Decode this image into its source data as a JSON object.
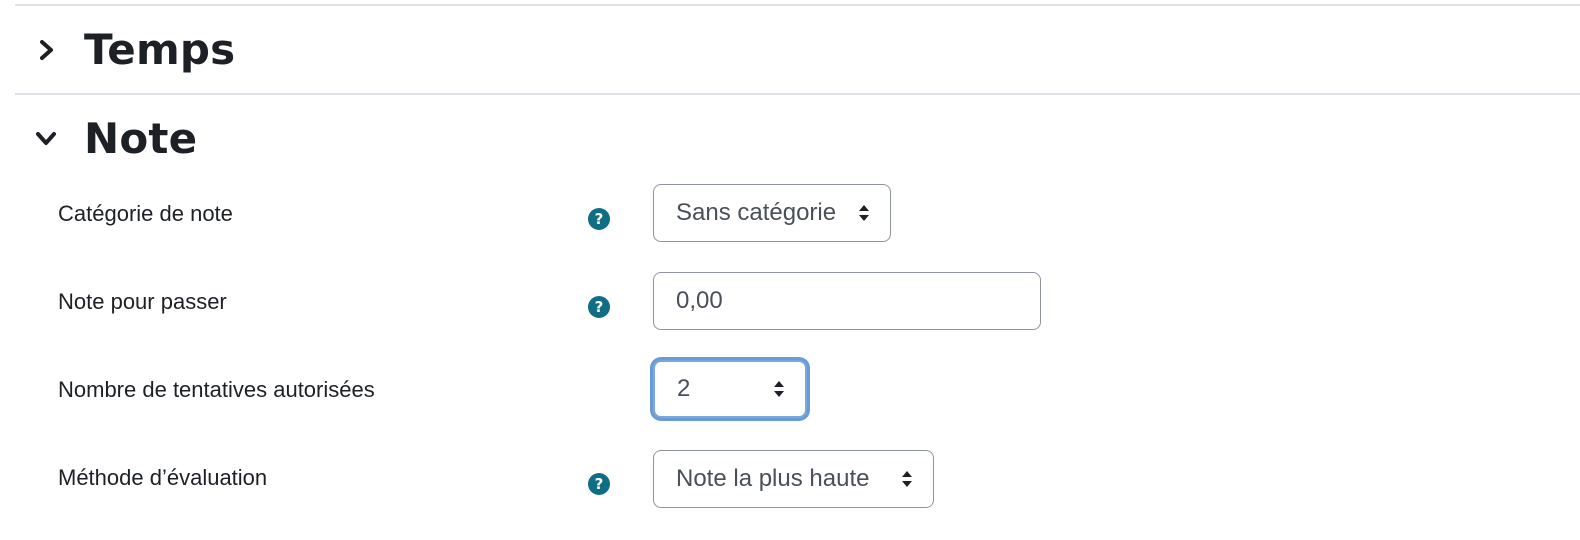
{
  "sections": {
    "temps": {
      "title": "Temps",
      "state": "collapsed",
      "icon": "chevron-right-icon"
    },
    "note": {
      "title": "Note",
      "state": "expanded",
      "icon": "chevron-down-icon"
    }
  },
  "fields": {
    "grade_category": {
      "label": "Catégorie de note",
      "value": "Sans catégorie",
      "has_help": true
    },
    "pass_grade": {
      "label": "Note pour passer",
      "value": "0,00",
      "has_help": true
    },
    "attempts": {
      "label": "Nombre de tentatives autorisées",
      "value": "2",
      "has_help": false,
      "focused": true
    },
    "grading_method": {
      "label": "Méthode d’évaluation",
      "value": "Note la plus haute",
      "has_help": true
    }
  },
  "help_icon_symbol": "?",
  "colors": {
    "help_icon": "#0f6e84",
    "focus_ring": "#6b9ad8",
    "text": "#1d2125",
    "input_text": "#495057",
    "border": "#8f959e",
    "divider": "#dee2e6"
  }
}
